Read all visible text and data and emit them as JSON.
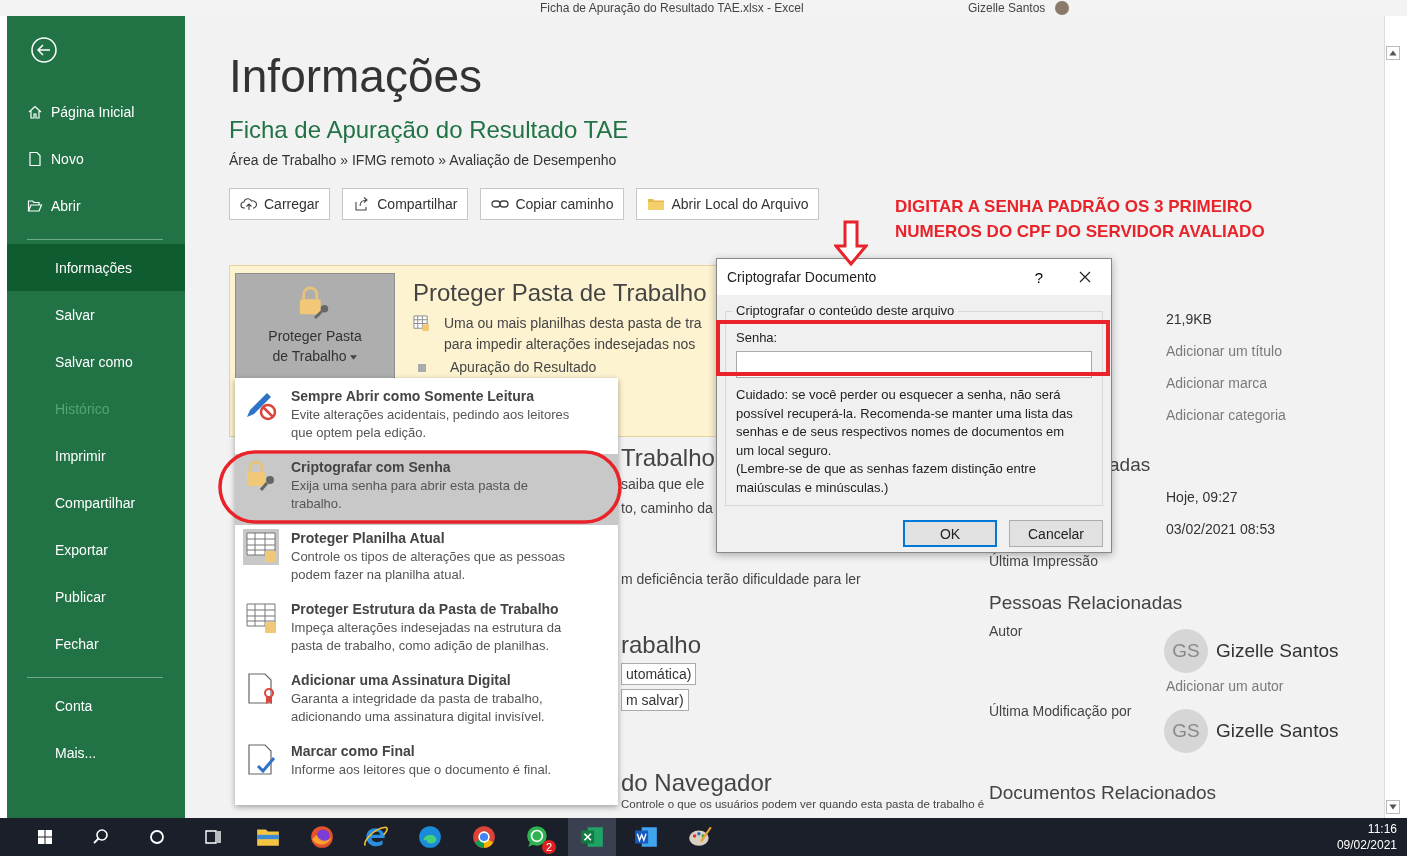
{
  "window": {
    "title": "Ficha de Apuração do Resultado TAE.xlsx  -  Excel",
    "user": "Gizelle Santos"
  },
  "sidebar": {
    "groups": [
      {
        "items": [
          {
            "label": "Página Inicial",
            "kind": "home",
            "selected": false,
            "disabled": false
          },
          {
            "label": "Novo",
            "kind": "new",
            "selected": false,
            "disabled": false
          },
          {
            "label": "Abrir",
            "kind": "open",
            "selected": false,
            "disabled": false
          }
        ]
      },
      {
        "items": [
          {
            "label": "Informações",
            "kind": "plain",
            "selected": true,
            "disabled": false
          },
          {
            "label": "Salvar",
            "kind": "plain",
            "selected": false,
            "disabled": false
          },
          {
            "label": "Salvar como",
            "kind": "plain",
            "selected": false,
            "disabled": false
          },
          {
            "label": "Histórico",
            "kind": "plain",
            "selected": false,
            "disabled": true
          },
          {
            "label": "Imprimir",
            "kind": "plain",
            "selected": false,
            "disabled": false
          },
          {
            "label": "Compartilhar",
            "kind": "plain",
            "selected": false,
            "disabled": false
          },
          {
            "label": "Exportar",
            "kind": "plain",
            "selected": false,
            "disabled": false
          },
          {
            "label": "Publicar",
            "kind": "plain",
            "selected": false,
            "disabled": false
          },
          {
            "label": "Fechar",
            "kind": "plain",
            "selected": false,
            "disabled": false
          }
        ]
      },
      {
        "items": [
          {
            "label": "Conta",
            "kind": "plain",
            "selected": false,
            "disabled": false
          },
          {
            "label": "Mais...",
            "kind": "plain",
            "selected": false,
            "disabled": false
          }
        ]
      }
    ]
  },
  "page": {
    "title": "Informações",
    "file_title": "Ficha de Apuração do Resultado TAE",
    "path": "Área de Trabalho » IFMG remoto » Avaliação de Desempenho",
    "actions": [
      {
        "label": "Carregar",
        "kind": "upload"
      },
      {
        "label": "Compartilhar",
        "kind": "share"
      },
      {
        "label": "Copiar caminho",
        "kind": "link"
      },
      {
        "label": "Abrir Local do Arquivo",
        "kind": "folder"
      }
    ]
  },
  "protect": {
    "button": "Proteger Pasta de Trabalho",
    "title": "Proteger Pasta de Trabalho",
    "lines": [
      "Uma ou mais planilhas desta pasta de tra",
      "para impedir alterações indesejadas nos"
    ],
    "bullet": "Apuração do Resultado"
  },
  "inspect": {
    "title": "Trabalho",
    "lines": [
      "saiba que ele",
      "to, caminho da"
    ],
    "note": "m deficiência terão dificuldade para ler"
  },
  "versions": {
    "title": "rabalho",
    "buttons": [
      "utomática)",
      "m salvar)"
    ]
  },
  "browser": {
    "title": "do Navegador",
    "text": "Controle o que os usuários podem ver quando esta pasta de trabalho é"
  },
  "properties": {
    "values": [
      {
        "text": "21,9KB",
        "kind": "value"
      },
      {
        "text": "Adicionar um título",
        "kind": "placeholder"
      },
      {
        "text": "Adicionar marca",
        "kind": "placeholder"
      },
      {
        "text": "Adicionar categoria",
        "kind": "placeholder"
      }
    ]
  },
  "dates": {
    "title": "adas",
    "values": [
      "Hoje, 09:27",
      "03/02/2021 08:53"
    ],
    "last_printed_label": "Última Impressão"
  },
  "people": {
    "title": "Pessoas Relacionadas",
    "author_label": "Autor",
    "author": {
      "initials": "GS",
      "name": "Gizelle Santos"
    },
    "add_author": "Adicionar um autor",
    "modified_label": "Última Modificação por",
    "modified_by": {
      "initials": "GS",
      "name": "Gizelle Santos"
    }
  },
  "documents": {
    "title": "Documentos Relacionados"
  },
  "menu": {
    "items": [
      {
        "title": "Sempre Abrir como Somente Leitura",
        "description": "Evite alterações acidentais, pedindo aos leitores que optem pela edição.",
        "kind": "readonly",
        "selected": false
      },
      {
        "title": "Criptografar com Senha",
        "description": "Exija uma senha para abrir esta pasta de trabalho.",
        "kind": "encrypt",
        "selected": true
      },
      {
        "title": "Proteger Planilha Atual",
        "description": "Controle os tipos de alterações que as pessoas podem fazer na planilha atual.",
        "kind": "sheet",
        "selected": false
      },
      {
        "title": "Proteger Estrutura da Pasta de Trabalho",
        "description": "Impeça alterações indesejadas na estrutura da pasta de trabalho, como adição de planilhas.",
        "kind": "structure",
        "selected": false
      },
      {
        "title": "Adicionar uma Assinatura Digital",
        "description": "Garanta a integridade da pasta de trabalho, adicionando uma assinatura digital invisível.",
        "kind": "signature",
        "selected": false
      },
      {
        "title": "Marcar como Final",
        "description": "Informe aos leitores que o documento é final.",
        "kind": "final",
        "selected": false
      }
    ]
  },
  "dialog": {
    "title": "Criptografar Documento",
    "help": "?",
    "group": "Criptografar o conteúdo deste arquivo",
    "field_label": "Senha:",
    "warning": "Cuidado: se você perder ou esquecer a senha, não será possível recuperá-la. Recomenda-se manter uma lista das senhas e de seus respectivos nomes de documentos em um local seguro.",
    "note": "(Lembre-se de que as senhas fazem distinção entre maiúsculas e minúsculas.)",
    "buttons": [
      {
        "label": "OK",
        "selected": true
      },
      {
        "label": "Cancelar",
        "selected": false
      }
    ]
  },
  "annotation": {
    "lines": [
      "DIGITAR A SENHA PADRÃO OS 3 PRIMEIRO",
      "NUMEROS DO CPF DO SERVIDOR AVALIADO"
    ]
  },
  "taskbar": {
    "apps": [
      {
        "kind": "folder",
        "active": false
      },
      {
        "kind": "fox",
        "active": false
      },
      {
        "kind": "ie",
        "active": false
      },
      {
        "kind": "wave",
        "active": false
      },
      {
        "kind": "ring",
        "active": false
      },
      {
        "kind": "chat",
        "active": false,
        "badge": "2"
      },
      {
        "kind": "sheet",
        "active": true
      },
      {
        "kind": "doc",
        "active": false
      },
      {
        "kind": "paint",
        "active": false
      }
    ],
    "time": "11:16",
    "date": "09/02/2021"
  }
}
